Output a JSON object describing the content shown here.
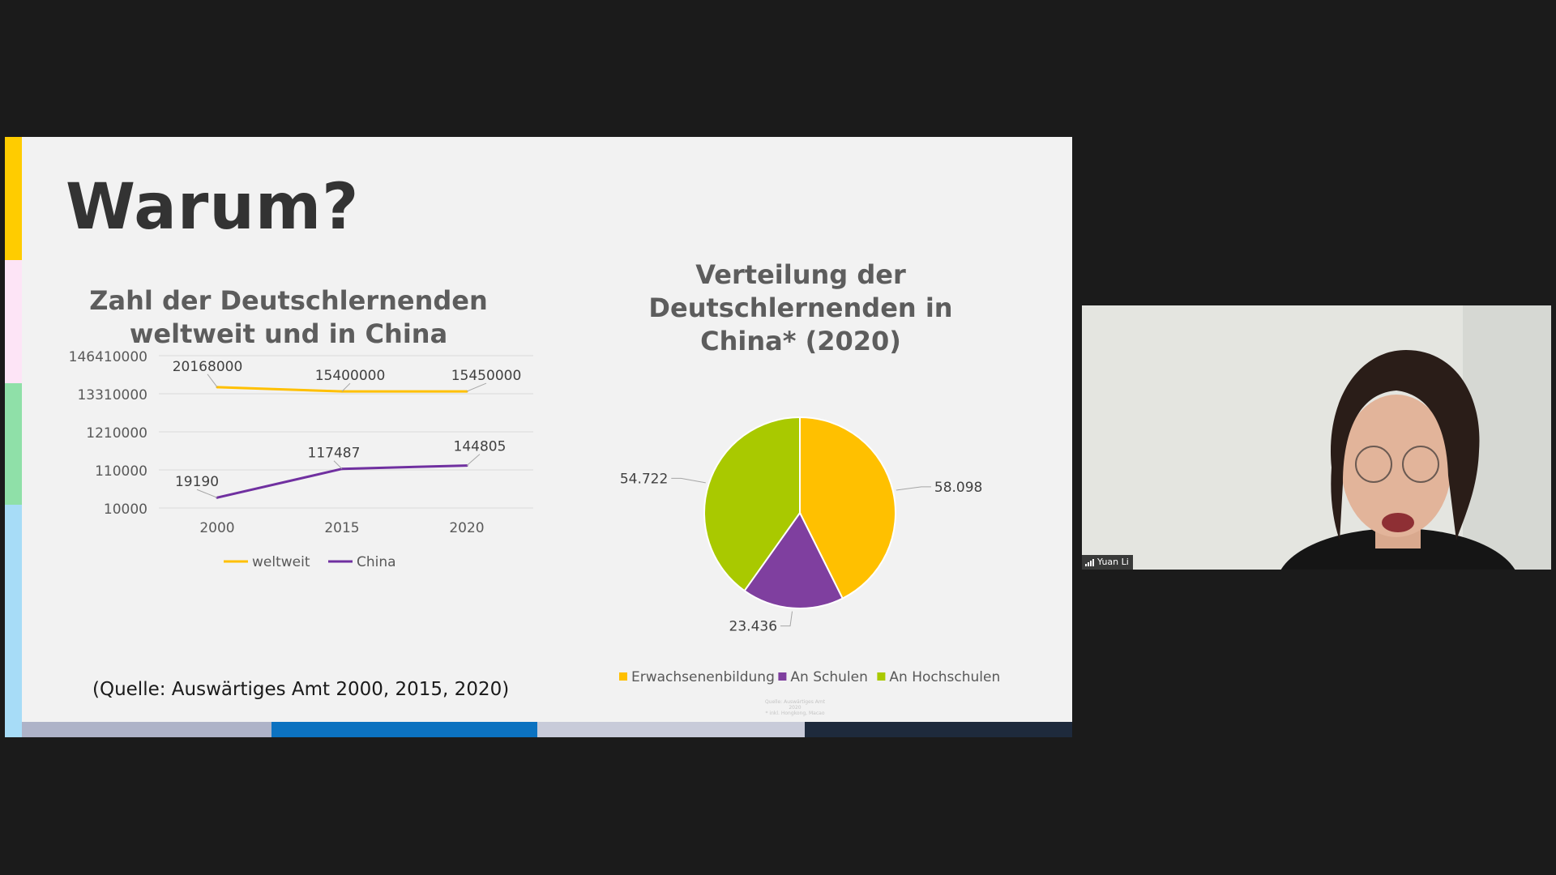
{
  "slide": {
    "title": "Warum?",
    "source_note": "(Quelle: Auswärtiges Amt 2000, 2015, 2020)",
    "footer_tiny_line1": "Quelle: Auswärtiges Amt 2020",
    "footer_tiny_line2": "* inkl. Hongkong, Macao",
    "accent_stripe_colors": [
      "#ffcc00",
      "#fde4f6",
      "#8fe0a8",
      "#a7dcf7"
    ],
    "bottom_bar_colors": [
      "#aeb3c8",
      "#0c72c0",
      "#c8cbd9",
      "#1e2a3c"
    ]
  },
  "chart_data": [
    {
      "type": "line",
      "title_lines": [
        "Zahl der Deutschlernenden",
        "weltweit und in China"
      ],
      "categories": [
        "2000",
        "2015",
        "2020"
      ],
      "y_tick_labels": [
        "146410000",
        "13310000",
        "1210000",
        "110000",
        "10000"
      ],
      "scale": "log",
      "grid": true,
      "legend_position": "bottom",
      "series": [
        {
          "name": "weltweit",
          "values": [
            20168000,
            15400000,
            15450000
          ],
          "color": "#ffc000"
        },
        {
          "name": "China",
          "values": [
            19190,
            117487,
            144805
          ],
          "color": "#7030a0"
        }
      ]
    },
    {
      "type": "pie",
      "title_lines": [
        "Verteilung der",
        "Deutschlernenden in",
        "China* (2020)"
      ],
      "legend_position": "bottom",
      "slices": [
        {
          "label": "Erwachsenenbildung",
          "value": 58098,
          "value_label": "58.098",
          "color": "#ffc000"
        },
        {
          "label": "An Schulen",
          "value": 23436,
          "value_label": "23.436",
          "color": "#7f3f9f"
        },
        {
          "label": "An Hochschulen",
          "value": 54722,
          "value_label": "54.722",
          "color": "#a9c900"
        }
      ]
    }
  ],
  "video": {
    "participant_name": "Yuan Li"
  }
}
